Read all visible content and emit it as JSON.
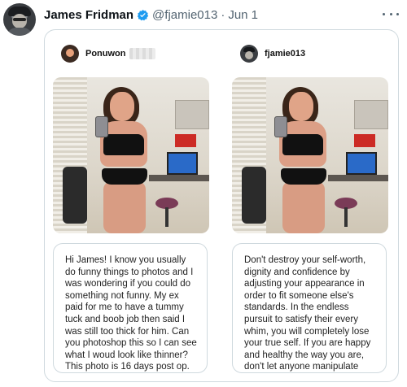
{
  "tweet": {
    "author_name": "James Fridman",
    "handle": "@fjamie013",
    "separator": "·",
    "date": "Jun 1"
  },
  "panels": [
    {
      "username": "Ponuwon",
      "message": "Hi James! I know you usually do funny things to photos and I was wondering if you could do something not funny. My ex paid for me to have a tummy tuck and boob job then said I was still too thick for him. Can you photoshop this so I can see what I woud look like thinner? This photo is 16 days post op."
    },
    {
      "username": "fjamie013",
      "message": "Don't destroy your self-worth, dignity and confidence by adjusting your appearance in order to fit someone else's standards. In the endless pursuit to satisfy their every whim, you will completely lose your true self. If you are happy and healthy the way you are, don't let anyone manipulate you into thinking you are not good enough."
    }
  ],
  "colors": {
    "verified_badge": "#1d9bf0",
    "muted_text": "#536471",
    "card_border": "#cfd9de"
  },
  "icons": {
    "verified": "verified-badge-icon",
    "more": "more-dots-icon"
  }
}
